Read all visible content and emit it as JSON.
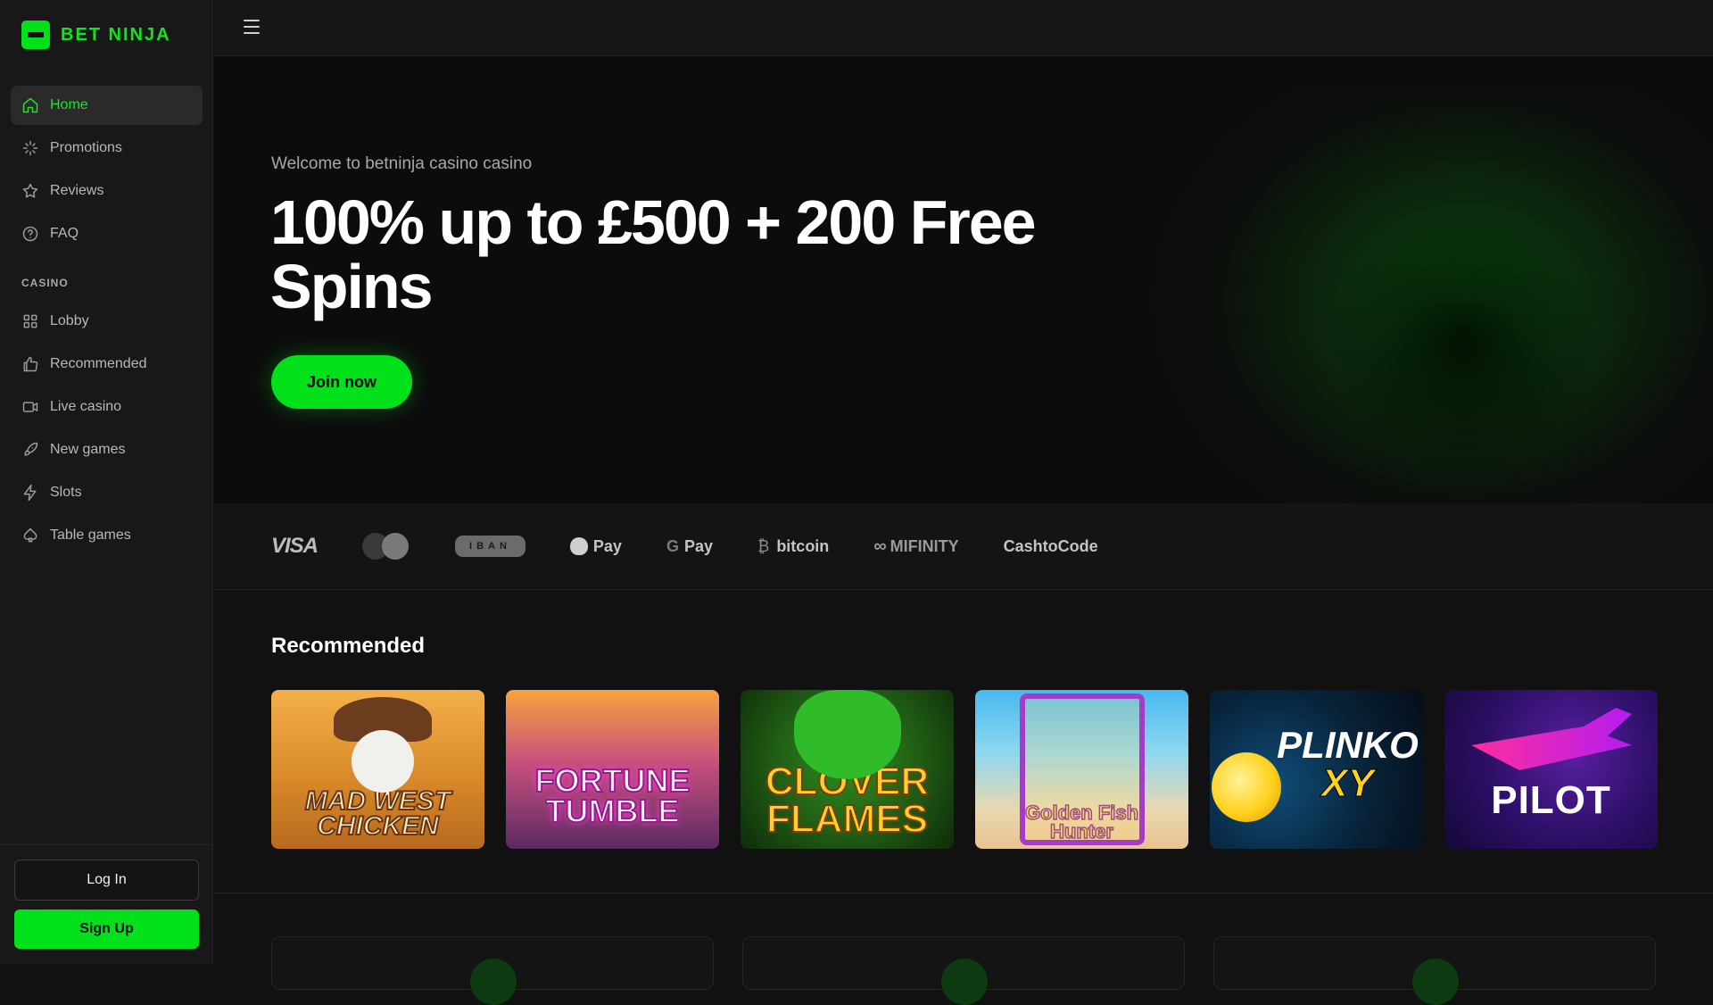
{
  "brand": {
    "name": "BET NINJA",
    "accent": "#00e11a"
  },
  "sidebar": {
    "nav": [
      {
        "label": "Home",
        "icon": "home-icon",
        "active": true
      },
      {
        "label": "Promotions",
        "icon": "sparkles-icon",
        "active": false
      },
      {
        "label": "Reviews",
        "icon": "star-icon",
        "active": false
      },
      {
        "label": "FAQ",
        "icon": "help-circle-icon",
        "active": false
      }
    ],
    "section_label": "CASINO",
    "casino": [
      {
        "label": "Lobby",
        "icon": "grid-icon"
      },
      {
        "label": "Recommended",
        "icon": "thumbs-up-icon"
      },
      {
        "label": "Live casino",
        "icon": "video-icon"
      },
      {
        "label": "New games",
        "icon": "rocket-icon"
      },
      {
        "label": "Slots",
        "icon": "bolt-icon"
      },
      {
        "label": "Table games",
        "icon": "spade-icon"
      }
    ],
    "login_label": "Log In",
    "signup_label": "Sign Up"
  },
  "hero": {
    "subtitle": "Welcome to betninja casino casino",
    "title": "100% up to £500 + 200 Free Spins",
    "cta": "Join now"
  },
  "payments": {
    "visa": "VISA",
    "iban": "IBAN",
    "apple_pay": "Pay",
    "google_g": "G",
    "google_pay": "Pay",
    "bitcoin_symbol": "₿",
    "bitcoin": "bitcoin",
    "mifinity": "MIFINITY",
    "cashtocode": "CashtoCode"
  },
  "recommended": {
    "title": "Recommended",
    "games": [
      {
        "line1": "Mad West",
        "line2": "Chicken"
      },
      {
        "line1": "Fortune",
        "line2": "Tumble"
      },
      {
        "line1": "Clover",
        "line2": "Flames"
      },
      {
        "line1": "Golden Fish",
        "line2": "Hunter"
      },
      {
        "line1": "Plinko",
        "line2": "XY"
      },
      {
        "line1": "Pilot",
        "line2": ""
      }
    ]
  }
}
